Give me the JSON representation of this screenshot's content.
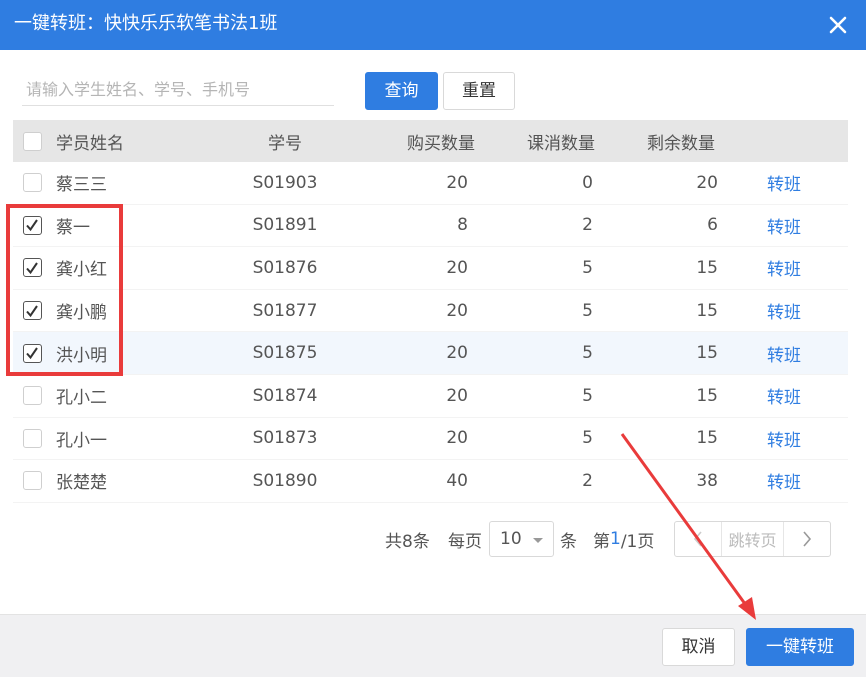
{
  "dialog": {
    "title": "一键转班：快快乐乐软笔书法1班"
  },
  "search": {
    "placeholder": "请输入学生姓名、学号、手机号",
    "value": "",
    "query_label": "查询",
    "reset_label": "重置"
  },
  "table": {
    "headers": {
      "name": "学员姓名",
      "no": "学号",
      "buy": "购买数量",
      "used": "课消数量",
      "rest": "剩余数量"
    },
    "rows": [
      {
        "name": "蔡三三",
        "no": "S01903",
        "buy": "20",
        "used": "0",
        "rest": "20",
        "action": "转班",
        "checked": false
      },
      {
        "name": "蔡一",
        "no": "S01891",
        "buy": "8",
        "used": "2",
        "rest": "6",
        "action": "转班",
        "checked": true
      },
      {
        "name": "龚小红",
        "no": "S01876",
        "buy": "20",
        "used": "5",
        "rest": "15",
        "action": "转班",
        "checked": true
      },
      {
        "name": "龚小鹏",
        "no": "S01877",
        "buy": "20",
        "used": "5",
        "rest": "15",
        "action": "转班",
        "checked": true
      },
      {
        "name": "洪小明",
        "no": "S01875",
        "buy": "20",
        "used": "5",
        "rest": "15",
        "action": "转班",
        "checked": true
      },
      {
        "name": "孔小二",
        "no": "S01874",
        "buy": "20",
        "used": "5",
        "rest": "15",
        "action": "转班",
        "checked": false
      },
      {
        "name": "孔小一",
        "no": "S01873",
        "buy": "20",
        "used": "5",
        "rest": "15",
        "action": "转班",
        "checked": false
      },
      {
        "name": "张楚楚",
        "no": "S01890",
        "buy": "40",
        "used": "2",
        "rest": "38",
        "action": "转班",
        "checked": false
      }
    ]
  },
  "pagination": {
    "total": "共8条",
    "per_page_label": "每页",
    "page_size": "10",
    "unit": "条",
    "page_prefix": "第",
    "current": "1",
    "page_suffix": "/1页",
    "jump_label": "跳转页"
  },
  "footer": {
    "cancel_label": "取消",
    "confirm_label": "一键转班"
  },
  "colors": {
    "primary": "#2f7de1",
    "annotation": "#e93b3b"
  }
}
